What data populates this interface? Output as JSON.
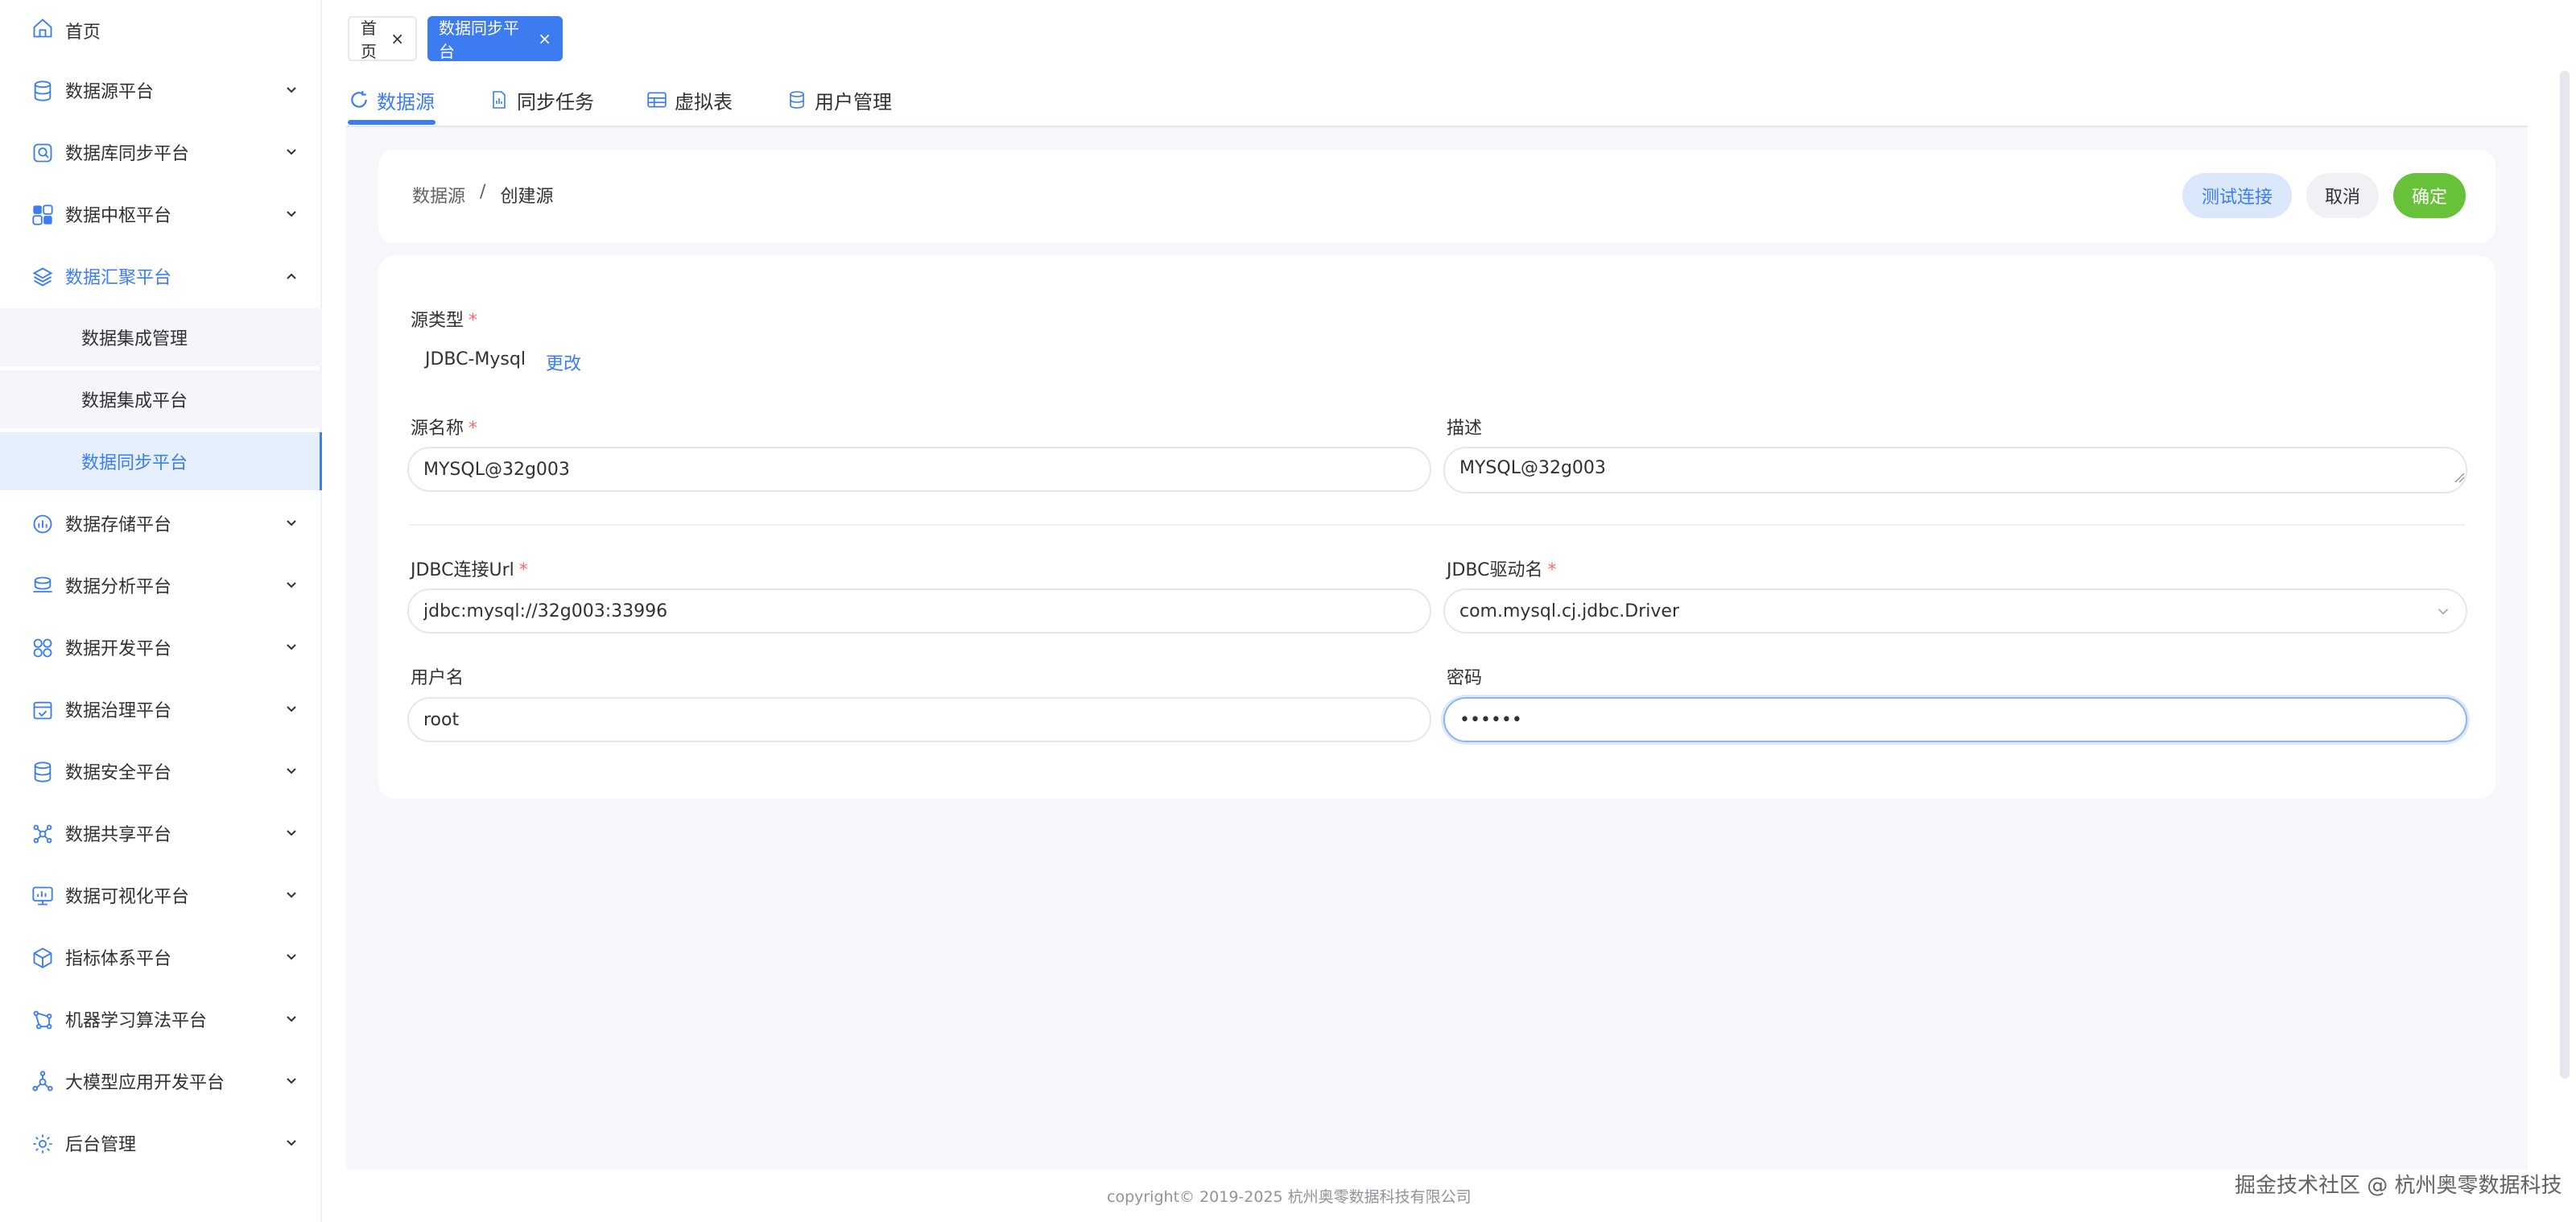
{
  "sidebar": {
    "items": [
      {
        "label": "首页",
        "icon": "home-icon",
        "expandable": false
      },
      {
        "label": "数据源平台",
        "icon": "database-icon",
        "expandable": true
      },
      {
        "label": "数据库同步平台",
        "icon": "db-sync-icon",
        "expandable": true
      },
      {
        "label": "数据中枢平台",
        "icon": "hub-icon",
        "expandable": true
      },
      {
        "label": "数据汇聚平台",
        "icon": "layers-icon",
        "expandable": true,
        "expanded": true
      },
      {
        "label": "数据存储平台",
        "icon": "storage-icon",
        "expandable": true
      },
      {
        "label": "数据分析平台",
        "icon": "analysis-icon",
        "expandable": true
      },
      {
        "label": "数据开发平台",
        "icon": "develop-icon",
        "expandable": true
      },
      {
        "label": "数据治理平台",
        "icon": "governance-icon",
        "expandable": true
      },
      {
        "label": "数据安全平台",
        "icon": "security-icon",
        "expandable": true
      },
      {
        "label": "数据共享平台",
        "icon": "share-icon",
        "expandable": true
      },
      {
        "label": "数据可视化平台",
        "icon": "visualization-icon",
        "expandable": true
      },
      {
        "label": "指标体系平台",
        "icon": "metrics-icon",
        "expandable": true
      },
      {
        "label": "机器学习算法平台",
        "icon": "ml-icon",
        "expandable": true
      },
      {
        "label": "大模型应用开发平台",
        "icon": "llm-icon",
        "expandable": true
      },
      {
        "label": "后台管理",
        "icon": "admin-gear-icon",
        "expandable": true
      }
    ],
    "submenu": [
      {
        "label": "数据集成管理",
        "selected": false
      },
      {
        "label": "数据集成平台",
        "selected": false
      },
      {
        "label": "数据同步平台",
        "selected": true
      }
    ]
  },
  "tags": {
    "home": "首页",
    "current": "数据同步平台",
    "close_glyph": "×"
  },
  "tabs": [
    {
      "label": "数据源",
      "icon": "refresh-icon",
      "active": true
    },
    {
      "label": "同步任务",
      "icon": "task-icon",
      "active": false
    },
    {
      "label": "虚拟表",
      "icon": "table-icon",
      "active": false
    },
    {
      "label": "用户管理",
      "icon": "user-db-icon",
      "active": false
    }
  ],
  "breadcrumb": {
    "root": "数据源",
    "separator": "/",
    "current": "创建源"
  },
  "actions": {
    "test": "测试连接",
    "cancel": "取消",
    "confirm": "确定"
  },
  "form": {
    "source_type": {
      "label": "源类型",
      "value": "JDBC-Mysql",
      "change_link": "更改"
    },
    "source_name": {
      "label": "源名称",
      "value": "MYSQL@32g003"
    },
    "description": {
      "label": "描述",
      "value": "MYSQL@32g003"
    },
    "jdbc_url": {
      "label": "JDBC连接Url",
      "value": "jdbc:mysql://32g003:33996"
    },
    "jdbc_driver": {
      "label": "JDBC驱动名",
      "value": "com.mysql.cj.jdbc.Driver"
    },
    "username": {
      "label": "用户名",
      "value": "root"
    },
    "password": {
      "label": "密码",
      "value": "••••••"
    },
    "required_mark": "*"
  },
  "footer": "copyright© 2019-2025 杭州奥零数据科技有限公司",
  "watermark": "掘金技术社区 @ 杭州奥零数据科技",
  "colors": {
    "accent": "#3c7cf0",
    "confirm": "#67c23a",
    "required": "#f56c6c"
  }
}
